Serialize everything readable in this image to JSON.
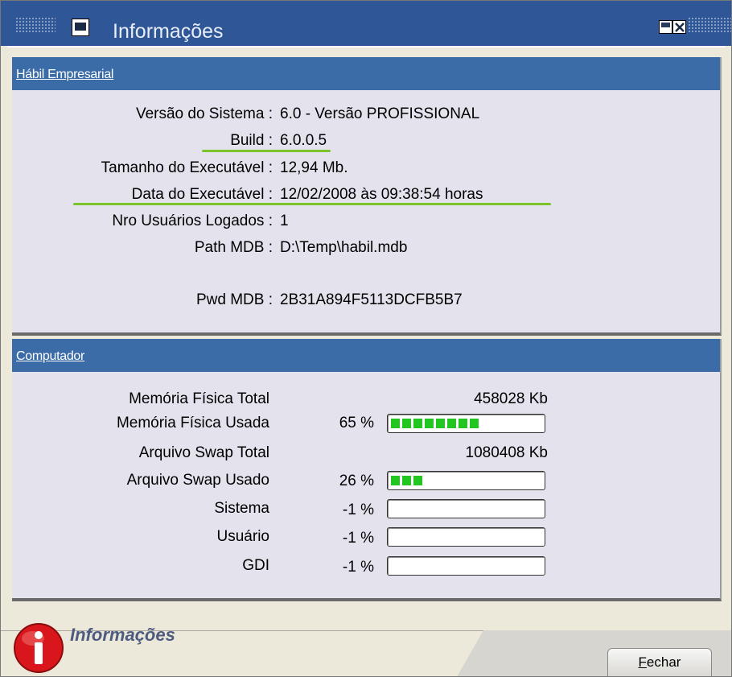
{
  "window": {
    "title": "Informações",
    "icons": [
      "system-menu-icon",
      "restore-icon",
      "close-icon"
    ]
  },
  "habil": {
    "header": "Hábil Empresarial",
    "rows": [
      {
        "label": "Versão do Sistema :",
        "value": "6.0 - Versão PROFISSIONAL"
      },
      {
        "label": "Build :",
        "value": "6.0.0.5"
      },
      {
        "label": "Tamanho do Executável :",
        "value": "12,94 Mb."
      },
      {
        "label": "Data do Executável :",
        "value": "12/02/2008 às 09:38:54 horas"
      },
      {
        "label": "Nro Usuários Logados :",
        "value": "1"
      },
      {
        "label": "Path MDB :",
        "value": "D:\\Temp\\habil.mdb"
      },
      {
        "label": "Pwd MDB :",
        "value": "2B31A894F5113DCFB5B7"
      }
    ]
  },
  "computer": {
    "header": "Computador",
    "memory_total": {
      "label": "Memória Física Total",
      "value": "458028  Kb"
    },
    "memory_used": {
      "label": "Memória Física Usada",
      "percent": "65 %",
      "fill": 0.65
    },
    "swap_total": {
      "label": "Arquivo Swap Total",
      "value": "1080408 Kb"
    },
    "swap_used": {
      "label": "Arquivo Swap Usado",
      "percent": "26 %",
      "fill": 0.26
    },
    "sistema": {
      "label": "Sistema",
      "percent": "-1 %",
      "fill": 0
    },
    "usuario": {
      "label": "Usuário",
      "percent": "-1 %",
      "fill": 0
    },
    "gdi": {
      "label": "GDI",
      "percent": "-1 %",
      "fill": 0
    }
  },
  "footer": {
    "title": "Informações",
    "close_label_first": "F",
    "close_label_rest": "echar",
    "icon": "info-icon"
  },
  "colors": {
    "titlebar": "#2F5696",
    "group_header": "#3B6CA8",
    "bar_fill": "#21C61E",
    "highlight_line": "#7CC42C"
  }
}
